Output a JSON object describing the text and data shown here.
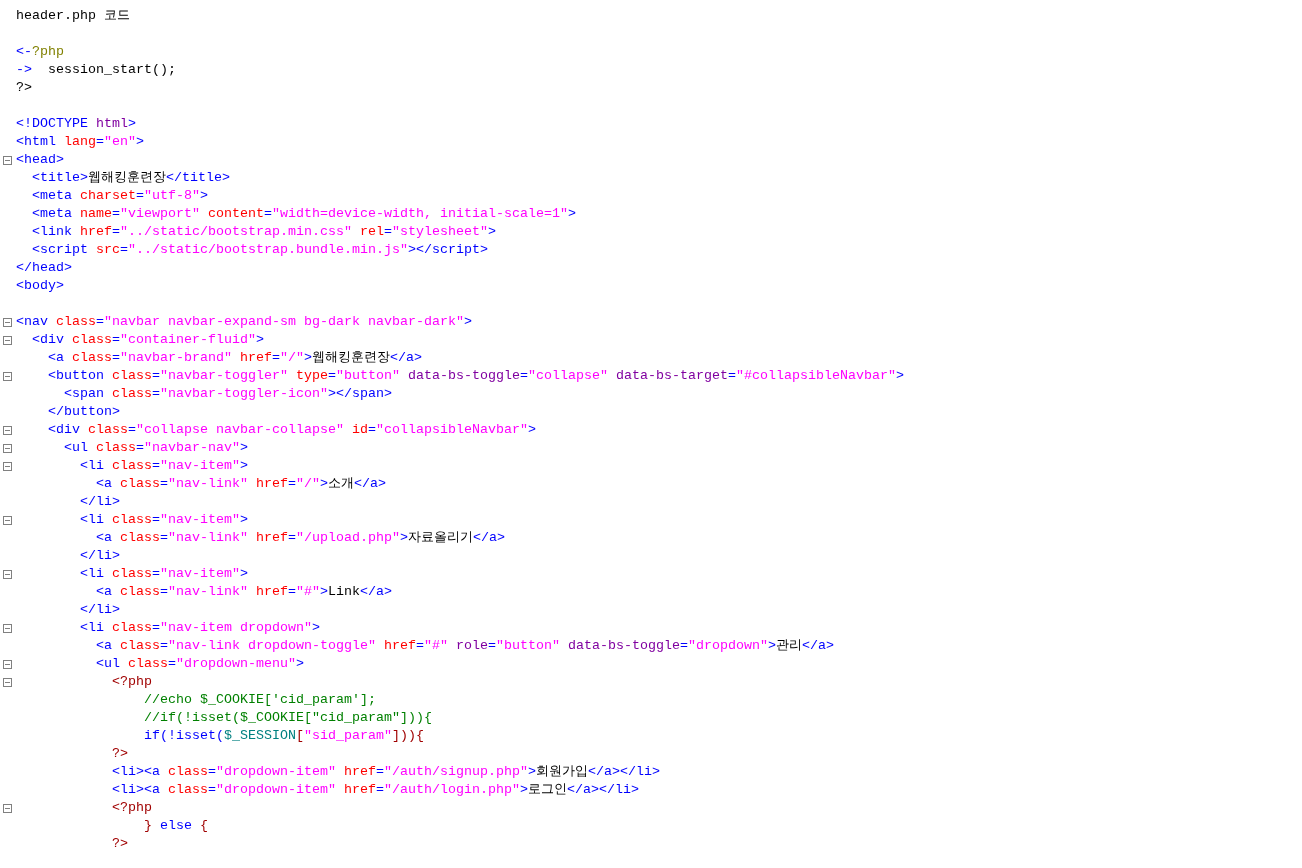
{
  "title": "header.php 코드",
  "blocks": [
    {
      "lines": [
        {
          "fold": false,
          "segments": [
            {
              "kind": "tag",
              "text": "<-"
            },
            {
              "kind": "phpopen",
              "text": "?php"
            }
          ]
        },
        {
          "fold": false,
          "segments": [
            {
              "kind": "tag",
              "text": "->"
            },
            {
              "kind": "text",
              "text": "  session_start();"
            }
          ]
        },
        {
          "fold": false,
          "segments": [
            {
              "kind": "text",
              "text": "?>"
            }
          ]
        }
      ]
    },
    {
      "lines": [
        {
          "fold": false,
          "segments": [
            {
              "kind": "tag",
              "text": "<!DOCTYPE"
            },
            {
              "kind": "dattr",
              "text": " html"
            },
            {
              "kind": "tag",
              "text": ">"
            }
          ]
        },
        {
          "fold": false,
          "segments": [
            {
              "kind": "tag",
              "text": "<html"
            },
            {
              "kind": "attr",
              "text": " lang"
            },
            {
              "kind": "tag",
              "text": "="
            },
            {
              "kind": "value",
              "text": "\"en\""
            },
            {
              "kind": "tag",
              "text": ">"
            }
          ]
        },
        {
          "fold": true,
          "segments": [
            {
              "kind": "tag",
              "text": "<head>"
            }
          ]
        },
        {
          "fold": false,
          "segments": [
            {
              "kind": "tag",
              "text": "  <title>"
            },
            {
              "kind": "text",
              "text": "웹해킹훈련장"
            },
            {
              "kind": "tag",
              "text": "</title>"
            }
          ]
        },
        {
          "fold": false,
          "segments": [
            {
              "kind": "tag",
              "text": "  <meta"
            },
            {
              "kind": "attr",
              "text": " charset"
            },
            {
              "kind": "tag",
              "text": "="
            },
            {
              "kind": "value",
              "text": "\"utf-8\""
            },
            {
              "kind": "tag",
              "text": ">"
            }
          ]
        },
        {
          "fold": false,
          "segments": [
            {
              "kind": "tag",
              "text": "  <meta"
            },
            {
              "kind": "attr",
              "text": " name"
            },
            {
              "kind": "tag",
              "text": "="
            },
            {
              "kind": "value",
              "text": "\"viewport\""
            },
            {
              "kind": "attr",
              "text": " content"
            },
            {
              "kind": "tag",
              "text": "="
            },
            {
              "kind": "value",
              "text": "\"width=device-width, initial-scale=1\""
            },
            {
              "kind": "tag",
              "text": ">"
            }
          ]
        },
        {
          "fold": false,
          "segments": [
            {
              "kind": "tag",
              "text": "  <link"
            },
            {
              "kind": "attr",
              "text": " href"
            },
            {
              "kind": "tag",
              "text": "="
            },
            {
              "kind": "value",
              "text": "\"../static/bootstrap.min.css\""
            },
            {
              "kind": "attr",
              "text": " rel"
            },
            {
              "kind": "tag",
              "text": "="
            },
            {
              "kind": "value",
              "text": "\"stylesheet\""
            },
            {
              "kind": "tag",
              "text": ">"
            }
          ]
        },
        {
          "fold": false,
          "segments": [
            {
              "kind": "tag",
              "text": "  <script"
            },
            {
              "kind": "attr",
              "text": " src"
            },
            {
              "kind": "tag",
              "text": "="
            },
            {
              "kind": "value",
              "text": "\"../static/bootstrap.bundle.min.js\""
            },
            {
              "kind": "tag",
              "text": "></script>"
            }
          ]
        },
        {
          "fold": false,
          "segments": [
            {
              "kind": "tag",
              "text": "</head>"
            }
          ]
        },
        {
          "fold": false,
          "segments": [
            {
              "kind": "tag",
              "text": "<body>"
            }
          ]
        }
      ]
    },
    {
      "lines": [
        {
          "fold": true,
          "segments": [
            {
              "kind": "tag",
              "text": "<nav"
            },
            {
              "kind": "attr",
              "text": " class"
            },
            {
              "kind": "tag",
              "text": "="
            },
            {
              "kind": "value",
              "text": "\"navbar navbar-expand-sm bg-dark navbar-dark\""
            },
            {
              "kind": "tag",
              "text": ">"
            }
          ]
        },
        {
          "fold": true,
          "segments": [
            {
              "kind": "tag",
              "text": "  <div"
            },
            {
              "kind": "attr",
              "text": " class"
            },
            {
              "kind": "tag",
              "text": "="
            },
            {
              "kind": "value",
              "text": "\"container-fluid\""
            },
            {
              "kind": "tag",
              "text": ">"
            }
          ]
        },
        {
          "fold": false,
          "segments": [
            {
              "kind": "tag",
              "text": "    <a"
            },
            {
              "kind": "attr",
              "text": " class"
            },
            {
              "kind": "tag",
              "text": "="
            },
            {
              "kind": "value",
              "text": "\"navbar-brand\""
            },
            {
              "kind": "attr",
              "text": " href"
            },
            {
              "kind": "tag",
              "text": "="
            },
            {
              "kind": "value",
              "text": "\"/\""
            },
            {
              "kind": "tag",
              "text": ">"
            },
            {
              "kind": "text",
              "text": "웹해킹훈련장"
            },
            {
              "kind": "tag",
              "text": "</a>"
            }
          ]
        },
        {
          "fold": true,
          "segments": [
            {
              "kind": "tag",
              "text": "    <button"
            },
            {
              "kind": "attr",
              "text": " class"
            },
            {
              "kind": "tag",
              "text": "="
            },
            {
              "kind": "value",
              "text": "\"navbar-toggler\""
            },
            {
              "kind": "attr",
              "text": " type"
            },
            {
              "kind": "tag",
              "text": "="
            },
            {
              "kind": "value",
              "text": "\"button\""
            },
            {
              "kind": "dattr",
              "text": " data-bs-toggle"
            },
            {
              "kind": "tag",
              "text": "="
            },
            {
              "kind": "value",
              "text": "\"collapse\""
            },
            {
              "kind": "dattr",
              "text": " data-bs-target"
            },
            {
              "kind": "tag",
              "text": "="
            },
            {
              "kind": "value",
              "text": "\"#collapsibleNavbar\""
            },
            {
              "kind": "tag",
              "text": ">"
            }
          ]
        },
        {
          "fold": false,
          "segments": [
            {
              "kind": "tag",
              "text": "      <span"
            },
            {
              "kind": "attr",
              "text": " class"
            },
            {
              "kind": "tag",
              "text": "="
            },
            {
              "kind": "value",
              "text": "\"navbar-toggler-icon\""
            },
            {
              "kind": "tag",
              "text": "></span>"
            }
          ]
        },
        {
          "fold": false,
          "segments": [
            {
              "kind": "tag",
              "text": "    </button>"
            }
          ]
        },
        {
          "fold": true,
          "segments": [
            {
              "kind": "tag",
              "text": "    <div"
            },
            {
              "kind": "attr",
              "text": " class"
            },
            {
              "kind": "tag",
              "text": "="
            },
            {
              "kind": "value",
              "text": "\"collapse navbar-collapse\""
            },
            {
              "kind": "attr",
              "text": " id"
            },
            {
              "kind": "tag",
              "text": "="
            },
            {
              "kind": "value",
              "text": "\"collapsibleNavbar\""
            },
            {
              "kind": "tag",
              "text": ">"
            }
          ]
        },
        {
          "fold": true,
          "segments": [
            {
              "kind": "tag",
              "text": "      <ul"
            },
            {
              "kind": "attr",
              "text": " class"
            },
            {
              "kind": "tag",
              "text": "="
            },
            {
              "kind": "value",
              "text": "\"navbar-nav\""
            },
            {
              "kind": "tag",
              "text": ">"
            }
          ]
        },
        {
          "fold": true,
          "segments": [
            {
              "kind": "tag",
              "text": "        <li"
            },
            {
              "kind": "attr",
              "text": " class"
            },
            {
              "kind": "tag",
              "text": "="
            },
            {
              "kind": "value",
              "text": "\"nav-item\""
            },
            {
              "kind": "tag",
              "text": ">"
            }
          ]
        },
        {
          "fold": false,
          "segments": [
            {
              "kind": "tag",
              "text": "          <a"
            },
            {
              "kind": "attr",
              "text": " class"
            },
            {
              "kind": "tag",
              "text": "="
            },
            {
              "kind": "value",
              "text": "\"nav-link\""
            },
            {
              "kind": "attr",
              "text": " href"
            },
            {
              "kind": "tag",
              "text": "="
            },
            {
              "kind": "value",
              "text": "\"/\""
            },
            {
              "kind": "tag",
              "text": ">"
            },
            {
              "kind": "text",
              "text": "소개"
            },
            {
              "kind": "tag",
              "text": "</a>"
            }
          ]
        },
        {
          "fold": false,
          "segments": [
            {
              "kind": "tag",
              "text": "        </li>"
            }
          ]
        },
        {
          "fold": true,
          "segments": [
            {
              "kind": "tag",
              "text": "        <li"
            },
            {
              "kind": "attr",
              "text": " class"
            },
            {
              "kind": "tag",
              "text": "="
            },
            {
              "kind": "value",
              "text": "\"nav-item\""
            },
            {
              "kind": "tag",
              "text": ">"
            }
          ]
        },
        {
          "fold": false,
          "segments": [
            {
              "kind": "tag",
              "text": "          <a"
            },
            {
              "kind": "attr",
              "text": " class"
            },
            {
              "kind": "tag",
              "text": "="
            },
            {
              "kind": "value",
              "text": "\"nav-link\""
            },
            {
              "kind": "attr",
              "text": " href"
            },
            {
              "kind": "tag",
              "text": "="
            },
            {
              "kind": "value",
              "text": "\"/upload.php\""
            },
            {
              "kind": "tag",
              "text": ">"
            },
            {
              "kind": "text",
              "text": "자료올리기"
            },
            {
              "kind": "tag",
              "text": "</a>"
            }
          ]
        },
        {
          "fold": false,
          "segments": [
            {
              "kind": "tag",
              "text": "        </li>"
            }
          ]
        },
        {
          "fold": true,
          "segments": [
            {
              "kind": "tag",
              "text": "        <li"
            },
            {
              "kind": "attr",
              "text": " class"
            },
            {
              "kind": "tag",
              "text": "="
            },
            {
              "kind": "value",
              "text": "\"nav-item\""
            },
            {
              "kind": "tag",
              "text": ">"
            }
          ]
        },
        {
          "fold": false,
          "segments": [
            {
              "kind": "tag",
              "text": "          <a"
            },
            {
              "kind": "attr",
              "text": " class"
            },
            {
              "kind": "tag",
              "text": "="
            },
            {
              "kind": "value",
              "text": "\"nav-link\""
            },
            {
              "kind": "attr",
              "text": " href"
            },
            {
              "kind": "tag",
              "text": "="
            },
            {
              "kind": "value",
              "text": "\"#\""
            },
            {
              "kind": "tag",
              "text": ">"
            },
            {
              "kind": "text",
              "text": "Link"
            },
            {
              "kind": "tag",
              "text": "</a>"
            }
          ]
        },
        {
          "fold": false,
          "segments": [
            {
              "kind": "tag",
              "text": "        </li>"
            }
          ]
        },
        {
          "fold": true,
          "segments": [
            {
              "kind": "tag",
              "text": "        <li"
            },
            {
              "kind": "attr",
              "text": " class"
            },
            {
              "kind": "tag",
              "text": "="
            },
            {
              "kind": "value",
              "text": "\"nav-item dropdown\""
            },
            {
              "kind": "tag",
              "text": ">"
            }
          ]
        },
        {
          "fold": false,
          "segments": [
            {
              "kind": "tag",
              "text": "          <a"
            },
            {
              "kind": "attr",
              "text": " class"
            },
            {
              "kind": "tag",
              "text": "="
            },
            {
              "kind": "value",
              "text": "\"nav-link dropdown-toggle\""
            },
            {
              "kind": "attr",
              "text": " href"
            },
            {
              "kind": "tag",
              "text": "="
            },
            {
              "kind": "value",
              "text": "\"#\""
            },
            {
              "kind": "dattr",
              "text": " role"
            },
            {
              "kind": "tag",
              "text": "="
            },
            {
              "kind": "value",
              "text": "\"button\""
            },
            {
              "kind": "dattr",
              "text": " data-bs-toggle"
            },
            {
              "kind": "tag",
              "text": "="
            },
            {
              "kind": "value",
              "text": "\"dropdown\""
            },
            {
              "kind": "tag",
              "text": ">"
            },
            {
              "kind": "text",
              "text": "관리"
            },
            {
              "kind": "tag",
              "text": "</a>"
            }
          ]
        },
        {
          "fold": true,
          "segments": [
            {
              "kind": "tag",
              "text": "          <ul"
            },
            {
              "kind": "attr",
              "text": " class"
            },
            {
              "kind": "tag",
              "text": "="
            },
            {
              "kind": "value",
              "text": "\"dropdown-menu\""
            },
            {
              "kind": "tag",
              "text": ">"
            }
          ]
        },
        {
          "fold": true,
          "segments": [
            {
              "kind": "phptag",
              "text": "            <?php"
            }
          ]
        },
        {
          "fold": false,
          "segments": [
            {
              "kind": "comment",
              "text": "                //echo $_COOKIE['cid_param'];"
            }
          ]
        },
        {
          "fold": false,
          "segments": [
            {
              "kind": "comment",
              "text": "                //if(!isset($_COOKIE[\"cid_param\"])){"
            }
          ]
        },
        {
          "fold": false,
          "segments": [
            {
              "kind": "phpkw",
              "text": "                if(!isset("
            },
            {
              "kind": "var",
              "text": "$_SESSION"
            },
            {
              "kind": "phptag",
              "text": "["
            },
            {
              "kind": "value",
              "text": "\"sid_param\""
            },
            {
              "kind": "phptag",
              "text": "])){"
            }
          ]
        },
        {
          "fold": false,
          "segments": [
            {
              "kind": "phptag",
              "text": "            ?>"
            }
          ]
        },
        {
          "fold": false,
          "segments": [
            {
              "kind": "tag",
              "text": "            <li><a"
            },
            {
              "kind": "attr",
              "text": " class"
            },
            {
              "kind": "tag",
              "text": "="
            },
            {
              "kind": "value",
              "text": "\"dropdown-item\""
            },
            {
              "kind": "attr",
              "text": " href"
            },
            {
              "kind": "tag",
              "text": "="
            },
            {
              "kind": "value",
              "text": "\"/auth/signup.php\""
            },
            {
              "kind": "tag",
              "text": ">"
            },
            {
              "kind": "text",
              "text": "회원가입"
            },
            {
              "kind": "tag",
              "text": "</a></li>"
            }
          ]
        },
        {
          "fold": false,
          "segments": [
            {
              "kind": "tag",
              "text": "            <li><a"
            },
            {
              "kind": "attr",
              "text": " class"
            },
            {
              "kind": "tag",
              "text": "="
            },
            {
              "kind": "value",
              "text": "\"dropdown-item\""
            },
            {
              "kind": "attr",
              "text": " href"
            },
            {
              "kind": "tag",
              "text": "="
            },
            {
              "kind": "value",
              "text": "\"/auth/login.php\""
            },
            {
              "kind": "tag",
              "text": ">"
            },
            {
              "kind": "text",
              "text": "로그인"
            },
            {
              "kind": "tag",
              "text": "</a></li>"
            }
          ]
        },
        {
          "fold": true,
          "segments": [
            {
              "kind": "phptag",
              "text": "            <?php"
            }
          ]
        },
        {
          "fold": false,
          "segments": [
            {
              "kind": "phptag",
              "text": "                }"
            },
            {
              "kind": "phpkw",
              "text": " else"
            },
            {
              "kind": "phptag",
              "text": " {"
            }
          ]
        },
        {
          "fold": false,
          "segments": [
            {
              "kind": "phptag",
              "text": "            ?>"
            }
          ]
        }
      ]
    }
  ]
}
